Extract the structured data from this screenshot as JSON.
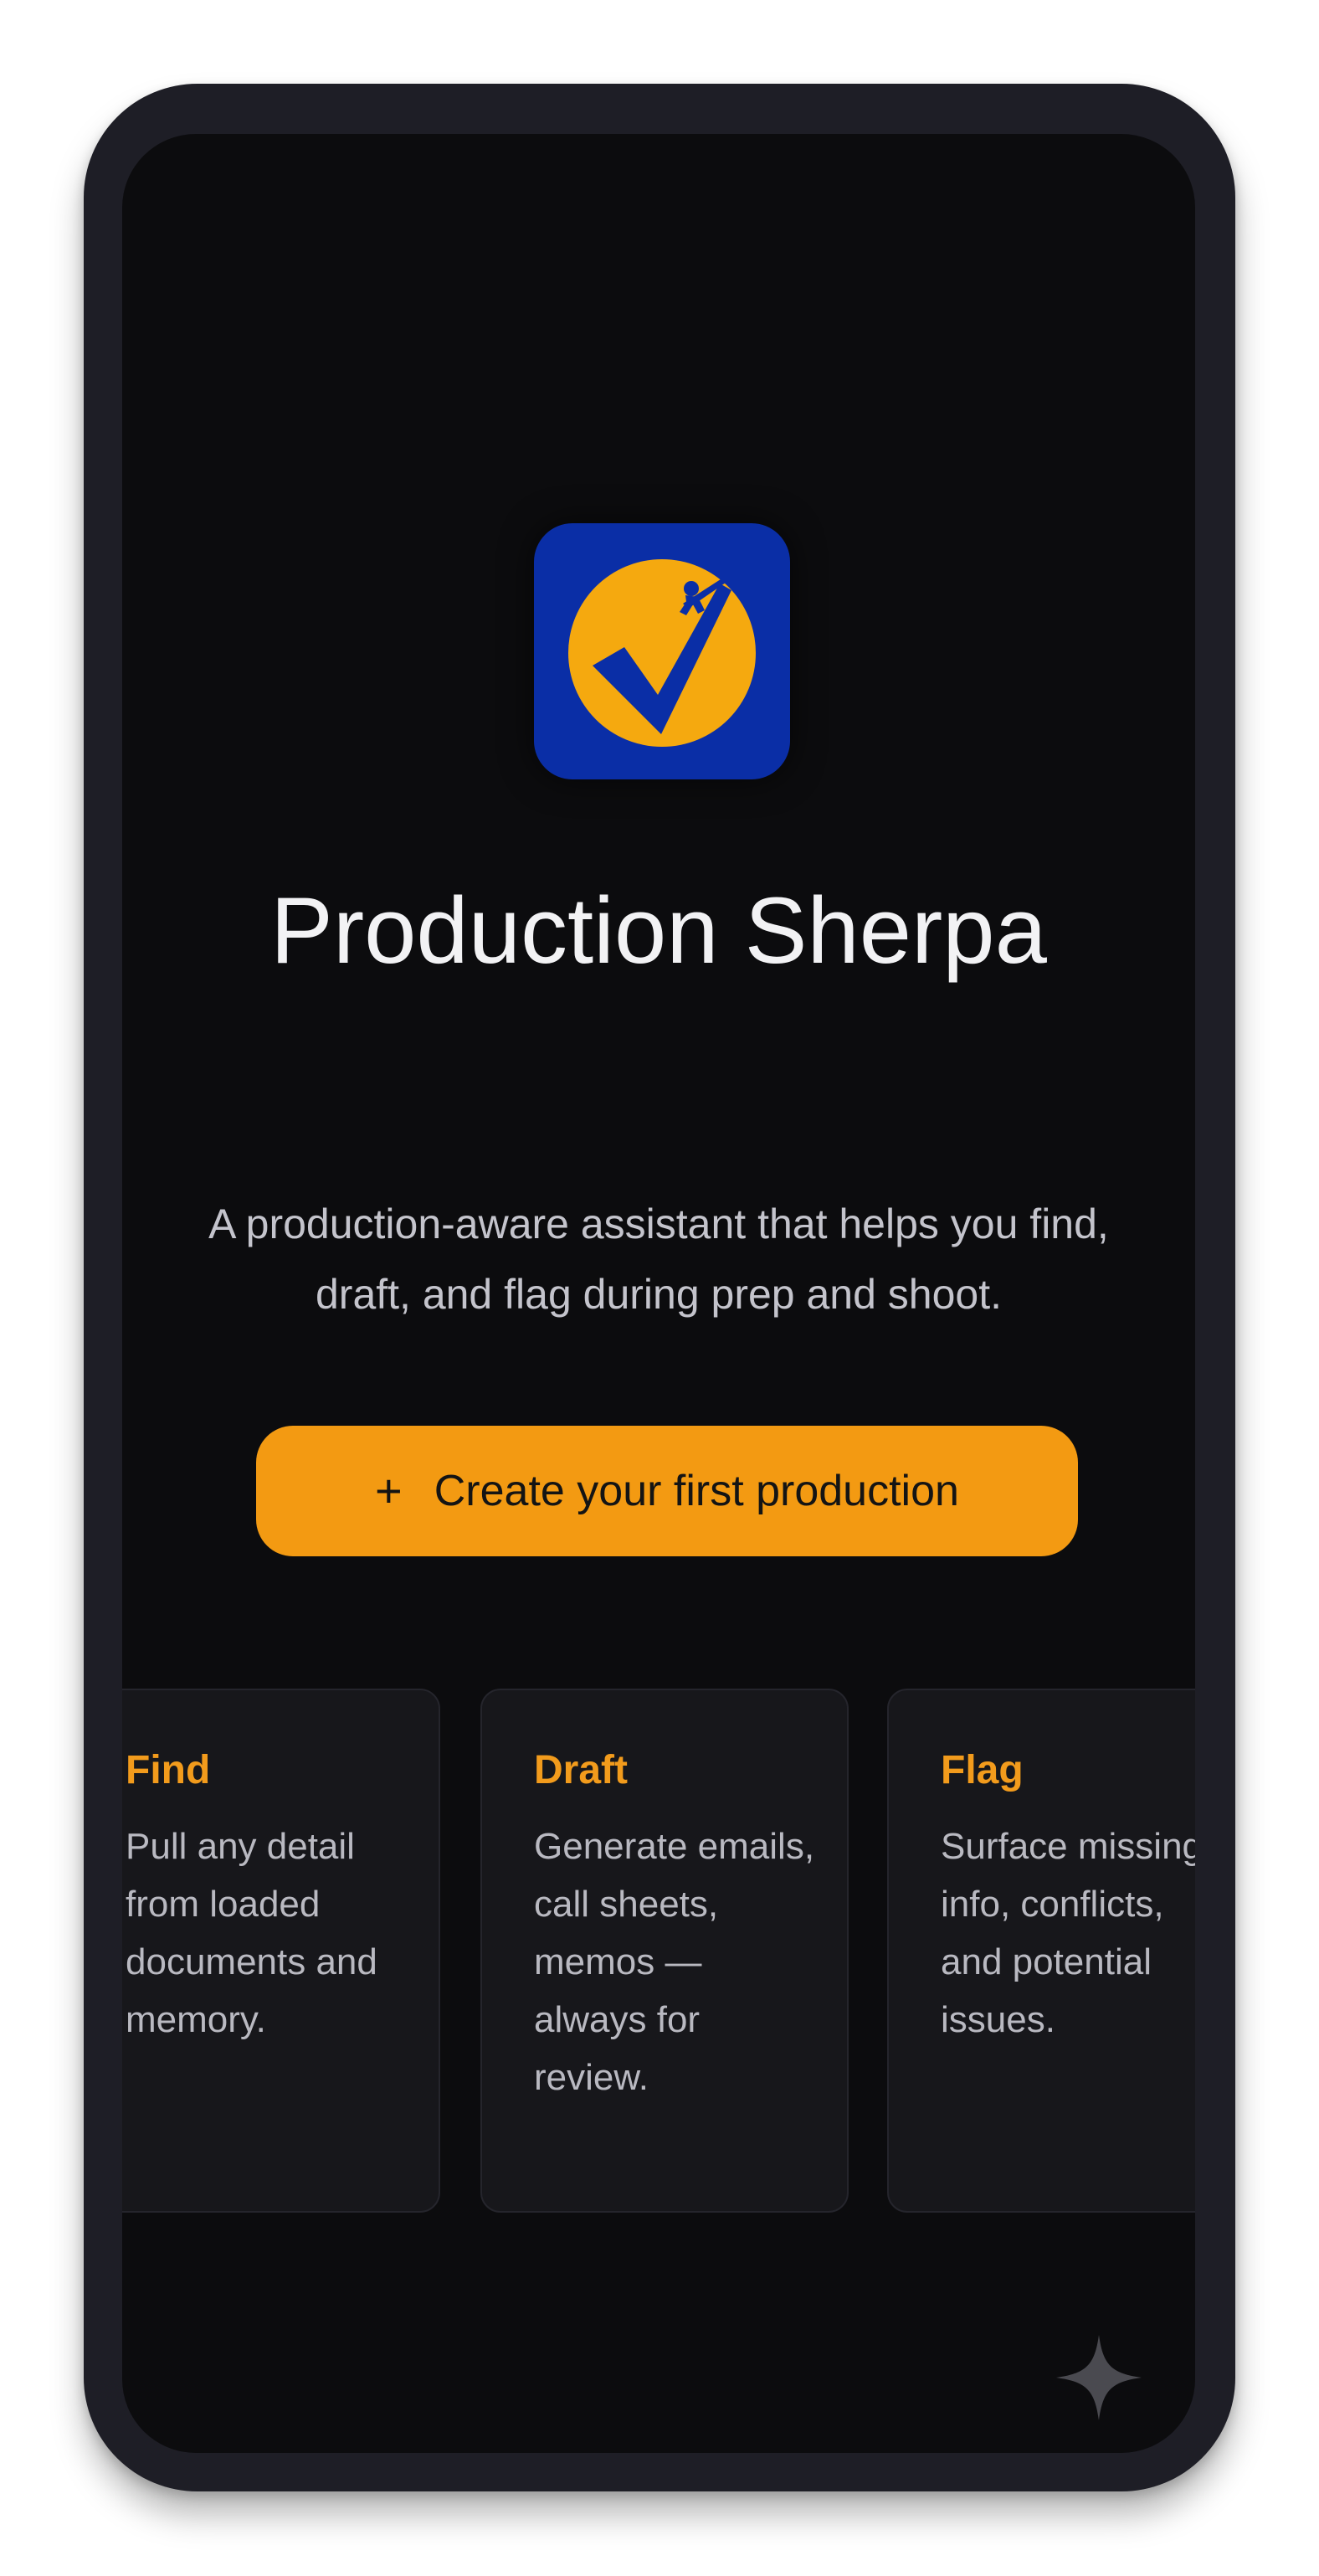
{
  "app": {
    "title": "Production Sherpa",
    "tagline_line1": "A production-aware assistant that helps you find,",
    "tagline_line2": "draft, and flag during prep and shoot.",
    "icon": "checkmark-climber-logo",
    "colors": {
      "accent": "#f39a12",
      "icon_background": "#0a2ea6",
      "screen_background": "#0c0c0e",
      "card_background": "#17171b"
    }
  },
  "cta": {
    "icon": "plus-icon",
    "plus": "+",
    "label": "Create your first production"
  },
  "features": [
    {
      "title": "Find",
      "description": "Pull any detail from loaded documents and memory."
    },
    {
      "title": "Draft",
      "description": "Generate emails, call sheets, memos — always for review."
    },
    {
      "title": "Flag",
      "description": "Surface missing info, conflicts, and potential issues."
    }
  ],
  "assistant_button": {
    "icon": "sparkle-icon"
  }
}
